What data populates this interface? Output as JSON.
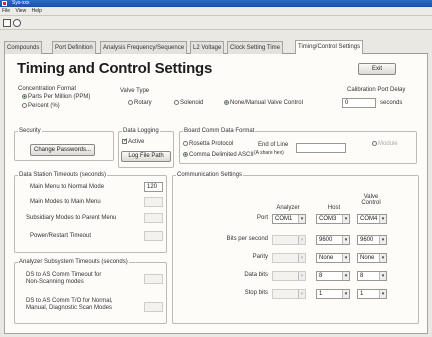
{
  "window": {
    "title": "Sys-xxx"
  },
  "menu": [
    "File",
    "View",
    "Help"
  ],
  "tabs": [
    "Compounds",
    "Port Definition",
    "Analysis Frequency/Sequence",
    "L2 Voltage",
    "Clock Setting Time",
    "Timing/Control Settings"
  ],
  "active_tab": 5,
  "page": {
    "title": "Timing and Control Settings",
    "exit_label": "Exit"
  },
  "concentration": {
    "label": "Concentration Format",
    "options": [
      "Parts Per Million (PPM)",
      "Percent (%)"
    ],
    "selected": 0
  },
  "valve": {
    "label": "Valve Type",
    "options": [
      "Rotary",
      "Solenoid",
      "None/Manual Valve Control"
    ],
    "selected": 2
  },
  "calibration": {
    "label": "Calibration Port Delay",
    "value": "0",
    "unit": "seconds"
  },
  "security": {
    "label": "Security",
    "button": "Change Passwords..."
  },
  "data_logging": {
    "label": "Data Logging",
    "active_label": "Active",
    "active": true,
    "button": "Log File Path"
  },
  "board_comm": {
    "label": "Board Comm Data Format",
    "options": [
      "Rosetta Protocol",
      "Comma Delimited ASCII"
    ],
    "selected": 1,
    "end_label": "End of Line",
    "end_sub": "(A share hex)",
    "end_value": "",
    "module_label": "Module"
  },
  "station_timeouts": {
    "label": "Data Station Timeouts (seconds)",
    "rows": [
      {
        "label": "Main Menu to Normal Mode",
        "value": "120",
        "enabled": true
      },
      {
        "label": "Main Modes to Main Menu",
        "value": "",
        "enabled": false
      },
      {
        "label": "Subsidiary Modes to Parent Menu",
        "value": "",
        "enabled": false
      },
      {
        "label": "Power/Restart Timeout",
        "value": "",
        "enabled": false
      }
    ]
  },
  "analyzer_timeouts": {
    "label": "Analyzer Subsystem Timeouts (seconds)",
    "rows": [
      {
        "label": "DS to AS Comm Timeout for Non-Scanning modes",
        "value": ""
      },
      {
        "label": "DS to AS Comm T/O for Normal, Manual, Diagnostic Scan Modes",
        "value": ""
      }
    ]
  },
  "comm": {
    "label": "Communication Settings",
    "columns": [
      "Analyzer",
      "Host",
      "Valve Control"
    ],
    "rows": [
      {
        "label": "Port",
        "values": [
          "COM1",
          "COM3",
          "COM4"
        ],
        "enabled": [
          true,
          true,
          true
        ]
      },
      {
        "label": "Bits per second",
        "values": [
          "",
          "9600",
          "9600"
        ],
        "enabled": [
          false,
          true,
          true
        ]
      },
      {
        "label": "Parity",
        "values": [
          "",
          "None",
          "None"
        ],
        "enabled": [
          false,
          true,
          true
        ]
      },
      {
        "label": "Data bits",
        "values": [
          "",
          "8",
          "8"
        ],
        "enabled": [
          false,
          true,
          true
        ]
      },
      {
        "label": "Stop bits",
        "values": [
          "",
          "1",
          "1"
        ],
        "enabled": [
          false,
          true,
          true
        ]
      }
    ]
  }
}
